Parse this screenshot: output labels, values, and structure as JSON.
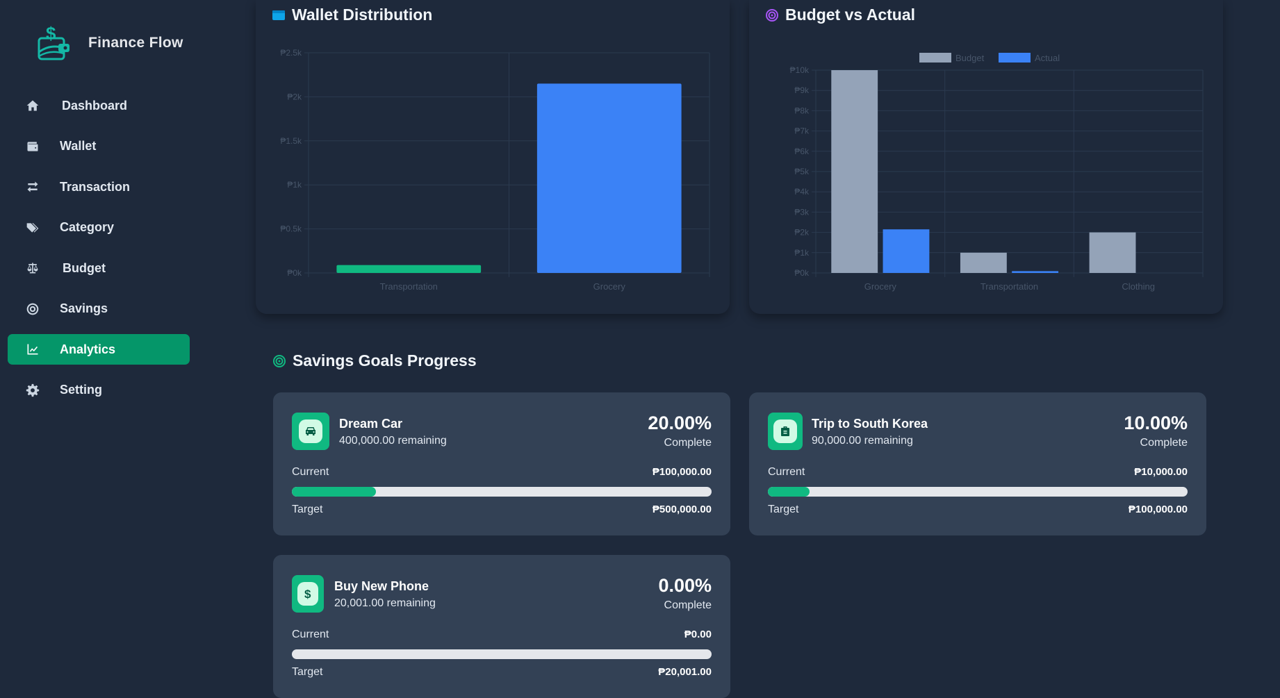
{
  "app": {
    "name": "Finance Flow"
  },
  "sidebar": {
    "items": [
      {
        "label": "Dashboard",
        "icon": "home-icon",
        "active": false
      },
      {
        "label": "Wallet",
        "icon": "wallet-icon",
        "active": false
      },
      {
        "label": "Transaction",
        "icon": "exchange-icon",
        "active": false
      },
      {
        "label": "Category",
        "icon": "tags-icon",
        "active": false
      },
      {
        "label": "Budget",
        "icon": "scale-icon",
        "active": false
      },
      {
        "label": "Savings",
        "icon": "target-icon",
        "active": false
      },
      {
        "label": "Analytics",
        "icon": "chart-line-icon",
        "active": true
      },
      {
        "label": "Setting",
        "icon": "gear-icon",
        "active": false
      }
    ]
  },
  "colors": {
    "accent": "#059669",
    "progress": "#10b981",
    "budget": "#94a3b8",
    "actual": "#3b82f6",
    "transportation": "#10b981",
    "grocery": "#3b82f6"
  },
  "wallet_panel": {
    "title": "Wallet Distribution"
  },
  "budget_panel": {
    "title": "Budget vs Actual"
  },
  "chart_data": [
    {
      "type": "bar",
      "title": "Wallet Distribution",
      "categories": [
        "Transportation",
        "Grocery"
      ],
      "values": [
        90,
        2150
      ],
      "colors": [
        "#10b981",
        "#3b82f6"
      ],
      "ylim": [
        0,
        2500
      ],
      "yticks": [
        "₱0k",
        "₱0.5k",
        "₱1k",
        "₱1.5k",
        "₱2k",
        "₱2.5k"
      ],
      "ytick_values": [
        0,
        500,
        1000,
        1500,
        2000,
        2500
      ],
      "grid": true
    },
    {
      "type": "bar",
      "title": "Budget vs Actual",
      "categories": [
        "Grocery",
        "Transportation",
        "Clothing"
      ],
      "series": [
        {
          "name": "Budget",
          "values": [
            10000,
            1000,
            2000
          ],
          "color": "#94a3b8"
        },
        {
          "name": "Actual",
          "values": [
            2150,
            90,
            0
          ],
          "color": "#3b82f6"
        }
      ],
      "ylim": [
        0,
        10000
      ],
      "yticks": [
        "₱0k",
        "₱1k",
        "₱2k",
        "₱3k",
        "₱4k",
        "₱5k",
        "₱6k",
        "₱7k",
        "₱8k",
        "₱9k",
        "₱10k"
      ],
      "ytick_values": [
        0,
        1000,
        2000,
        3000,
        4000,
        5000,
        6000,
        7000,
        8000,
        9000,
        10000
      ],
      "legend": "top",
      "grid": true
    }
  ],
  "savings": {
    "title": "Savings Goals Progress",
    "goals": [
      {
        "name": "Dream Car",
        "remaining": "400,000.00 remaining",
        "percent": "20.00%",
        "complete_label": "Complete",
        "current_label": "Current",
        "current": "₱100,000.00",
        "target_label": "Target",
        "target": "₱500,000.00",
        "progress": 0.2,
        "icon": "car-icon"
      },
      {
        "name": "Trip to South Korea",
        "remaining": "90,000.00 remaining",
        "percent": "10.00%",
        "complete_label": "Complete",
        "current_label": "Current",
        "current": "₱10,000.00",
        "target_label": "Target",
        "target": "₱100,000.00",
        "progress": 0.1,
        "icon": "suitcase-icon"
      },
      {
        "name": "Buy New Phone",
        "remaining": "20,001.00 remaining",
        "percent": "0.00%",
        "complete_label": "Complete",
        "current_label": "Current",
        "current": "₱0.00",
        "target_label": "Target",
        "target": "₱20,001.00",
        "progress": 0.0,
        "icon": "dollar-icon"
      }
    ]
  }
}
